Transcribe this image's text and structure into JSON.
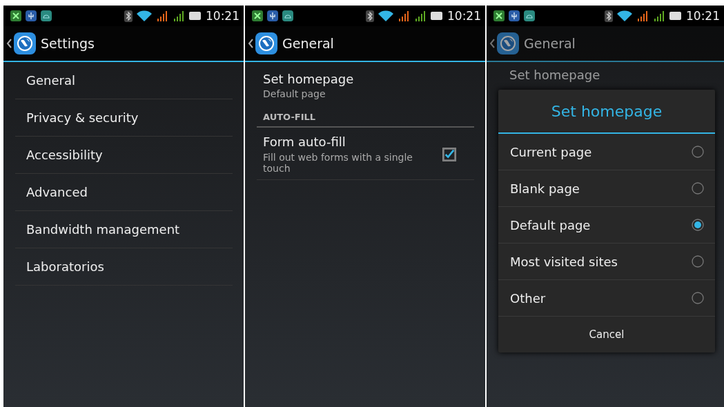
{
  "screens": [
    {
      "status_bar": {
        "time": "10:21"
      },
      "header": {
        "title": "Settings"
      },
      "dimmed": false,
      "items": [
        {
          "kind": "single",
          "title": "General"
        },
        {
          "kind": "single",
          "title": "Privacy & security"
        },
        {
          "kind": "single",
          "title": "Accessibility"
        },
        {
          "kind": "single",
          "title": "Advanced"
        },
        {
          "kind": "single",
          "title": "Bandwidth management"
        },
        {
          "kind": "single",
          "title": "Laboratorios"
        }
      ]
    },
    {
      "status_bar": {
        "time": "10:21"
      },
      "header": {
        "title": "General"
      },
      "dimmed": false,
      "items": [
        {
          "kind": "two_line",
          "title": "Set homepage",
          "summary": "Default page"
        },
        {
          "kind": "category",
          "title": "AUTO-FILL"
        },
        {
          "kind": "checkbox",
          "title": "Form auto-fill",
          "summary": "Fill out web forms with a single touch",
          "checked": true
        }
      ]
    },
    {
      "status_bar": {
        "time": "10:21"
      },
      "header": {
        "title": "General"
      },
      "dimmed": true,
      "items": [
        {
          "kind": "single",
          "title": "Set homepage"
        }
      ],
      "dialog": {
        "title": "Set homepage",
        "options": [
          {
            "label": "Current page",
            "selected": false
          },
          {
            "label": "Blank page",
            "selected": false
          },
          {
            "label": "Default page",
            "selected": true
          },
          {
            "label": "Most visited sites",
            "selected": false
          },
          {
            "label": "Other",
            "selected": false
          }
        ],
        "button": "Cancel"
      }
    }
  ]
}
